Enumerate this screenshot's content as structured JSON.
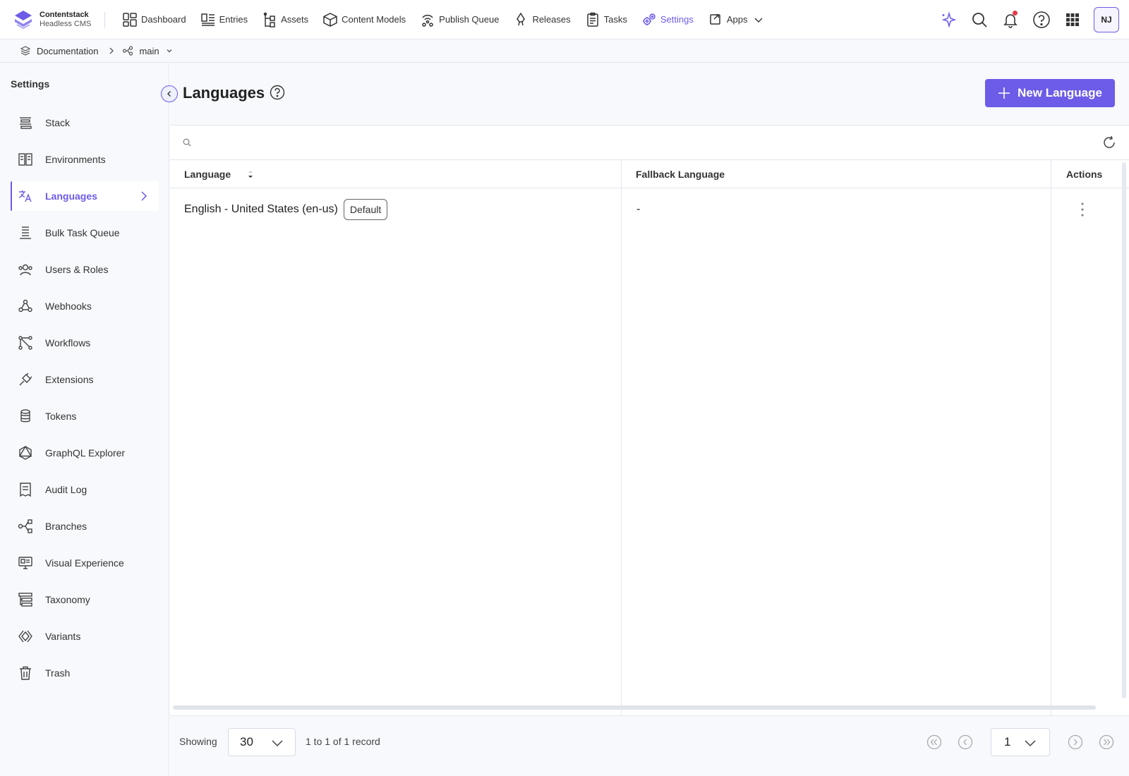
{
  "brand": {
    "name": "Contentstack",
    "subtitle": "Headless CMS"
  },
  "nav": {
    "items": [
      {
        "label": "Dashboard",
        "icon": "dashboard-icon"
      },
      {
        "label": "Entries",
        "icon": "entries-icon"
      },
      {
        "label": "Assets",
        "icon": "assets-icon"
      },
      {
        "label": "Content Models",
        "icon": "cube-icon"
      },
      {
        "label": "Publish Queue",
        "icon": "broadcast-icon"
      },
      {
        "label": "Releases",
        "icon": "rocket-icon"
      },
      {
        "label": "Tasks",
        "icon": "clipboard-icon"
      },
      {
        "label": "Settings",
        "icon": "gears-icon",
        "active": true
      },
      {
        "label": "Apps",
        "icon": "apps-icon"
      }
    ],
    "accent_color": "#6c5ce7"
  },
  "user": {
    "initials": "NJ"
  },
  "breadcrumb": {
    "stack": "Documentation",
    "branch": "main"
  },
  "sidebar": {
    "title": "Settings",
    "items": [
      {
        "label": "Stack"
      },
      {
        "label": "Environments"
      },
      {
        "label": "Languages",
        "active": true
      },
      {
        "label": "Bulk Task Queue"
      },
      {
        "label": "Users & Roles"
      },
      {
        "label": "Webhooks"
      },
      {
        "label": "Workflows"
      },
      {
        "label": "Extensions"
      },
      {
        "label": "Tokens"
      },
      {
        "label": "GraphQL Explorer"
      },
      {
        "label": "Audit Log"
      },
      {
        "label": "Branches"
      },
      {
        "label": "Visual Experience"
      },
      {
        "label": "Taxonomy"
      },
      {
        "label": "Variants"
      },
      {
        "label": "Trash"
      }
    ]
  },
  "page": {
    "title": "Languages",
    "new_button": "New Language"
  },
  "table": {
    "search_placeholder": "",
    "columns": [
      "Language",
      "Fallback Language",
      "Actions"
    ],
    "rows": [
      {
        "language": "English - United States (en-us)",
        "badge": "Default",
        "fallback": "-"
      }
    ]
  },
  "footer": {
    "showing_label": "Showing",
    "page_size": "30",
    "range_text": "1 to 1 of 1 record",
    "current_page": "1"
  }
}
